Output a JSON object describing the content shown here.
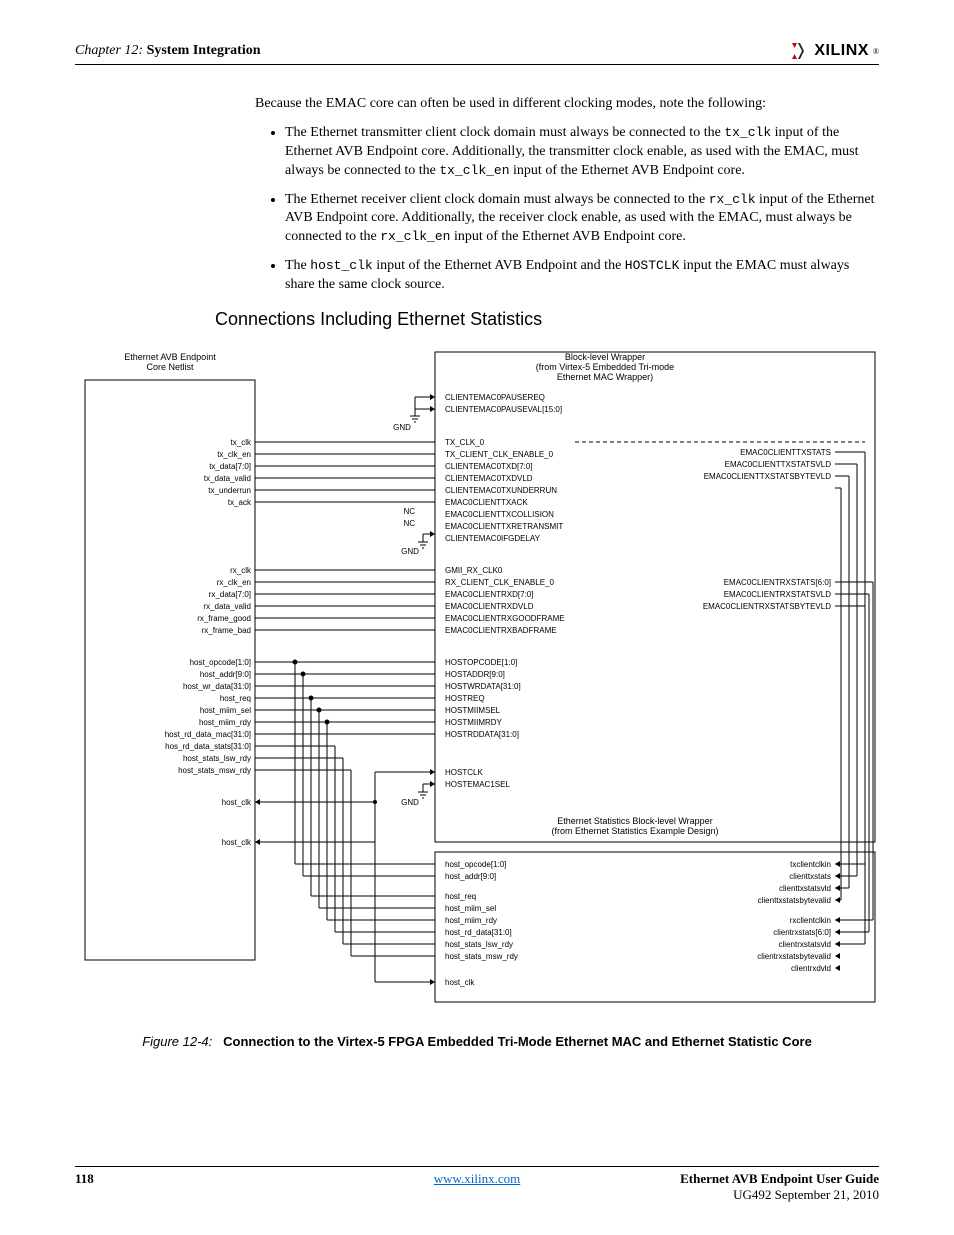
{
  "header": {
    "chapter": "Chapter 12:",
    "title": "System Integration",
    "logo": "XILINX"
  },
  "intro": "Because the EMAC core can often be used in different clocking modes, note the following:",
  "bullets": [
    {
      "pre": "The Ethernet transmitter client clock domain must always be connected to the ",
      "m1": "tx_clk",
      "mid1": " input of the Ethernet AVB Endpoint core. Additionally, the transmitter clock enable, as used with the EMAC, must always be connected to the ",
      "m2": "tx_clk_en",
      "post": " input of the Ethernet AVB Endpoint core."
    },
    {
      "pre": "The Ethernet receiver client clock domain must always be connected to the ",
      "m1": "rx_clk",
      "mid1": " input of the Ethernet AVB Endpoint core. Additionally, the receiver clock enable, as used with the EMAC, must always be connected to the ",
      "m2": "rx_clk_en",
      "post": " input of the Ethernet AVB Endpoint core."
    },
    {
      "pre": "The ",
      "m1": "host_clk",
      "mid1": " input of the Ethernet AVB Endpoint and the ",
      "m2": "HOSTCLK",
      "post": " input the EMAC must always share the same clock source."
    }
  ],
  "section_heading": "Connections Including Ethernet Statistics",
  "diagram": {
    "avb_title1": "Ethernet AVB Endpoint",
    "avb_title2": "Core Netlist",
    "wrap_title1": "Block-level Wrapper",
    "wrap_title2": "(from Virtex-5 Embedded Tri-mode",
    "wrap_title3": "Ethernet MAC Wrapper)",
    "stats_title1": "Ethernet Statistics Block-level Wrapper",
    "stats_title2": "(from Ethernet Statistics Example Design)",
    "gnd": "GND",
    "nc": "NC",
    "pause1": "CLIENTEMAC0PAUSEREQ",
    "pause2": "CLIENTEMAC0PAUSEVAL[15:0]",
    "avb_tx": [
      "tx_clk",
      "tx_clk_en",
      "tx_data[7:0]",
      "tx_data_valid",
      "tx_underrun",
      "tx_ack"
    ],
    "wrap_tx": [
      "TX_CLK_0",
      "TX_CLIENT_CLK_ENABLE_0",
      "CLIENTEMAC0TXD[7:0]",
      "CLIENTEMAC0TXDVLD",
      "CLIENTEMAC0TXUNDERRUN",
      "EMAC0CLIENTTXACK",
      "EMAC0CLIENTTXCOLLISION",
      "EMAC0CLIENTTXRETRANSMIT",
      "CLIENTEMAC0IFGDELAY"
    ],
    "wrap_tx_r": [
      "EMAC0CLIENTTXSTATS",
      "EMAC0CLIENTTXSTATSVLD",
      "EMAC0CLIENTTXSTATSBYTEVLD"
    ],
    "avb_rx": [
      "rx_clk",
      "rx_clk_en",
      "rx_data[7:0]",
      "rx_data_valid",
      "rx_frame_good",
      "rx_frame_bad"
    ],
    "wrap_rx": [
      "GMII_RX_CLK0",
      "RX_CLIENT_CLK_ENABLE_0",
      "EMAC0CLIENTRXD[7:0]",
      "EMAC0CLIENTRXDVLD",
      "EMAC0CLIENTRXGOODFRAME",
      "EMAC0CLIENTRXBADFRAME"
    ],
    "wrap_rx_r": [
      "EMAC0CLIENTRXSTATS[6:0]",
      "EMAC0CLIENTRXSTATSVLD",
      "EMAC0CLIENTRXSTATSBYTEVLD"
    ],
    "avb_host": [
      "host_opcode[1:0]",
      "host_addr[9:0]",
      "host_wr_data[31:0]",
      "host_req",
      "host_miim_sel",
      "host_miim_rdy",
      "host_rd_data_mac[31:0]",
      "hos_rd_data_stats[31:0]",
      "host_stats_lsw_rdy",
      "host_stats_msw_rdy"
    ],
    "wrap_host": [
      "HOSTOPCODE[1:0]",
      "HOSTADDR[9:0]",
      "HOSTWRDATA[31:0]",
      "HOSTREQ",
      "HOSTMIIMSEL",
      "HOSTMIIMRDY",
      "HOSTRDDATA[31:0]"
    ],
    "wrap_host2": [
      "HOSTCLK",
      "HOSTEMAC1SEL"
    ],
    "avb_hostclk": "host_clk",
    "avb_hostclk2": "host_clk",
    "stats_l": [
      "host_opcode[1:0]",
      "host_addr[9:0]"
    ],
    "stats_l2": [
      "host_req",
      "host_miim_sel",
      "host_miim_rdy",
      "host_rd_data[31:0]",
      "host_stats_lsw_rdy",
      "host_stats_msw_rdy"
    ],
    "stats_l3": "host_clk",
    "stats_r": [
      "txclientclkin",
      "clienttxstats",
      "clienttxstatsvld",
      "clienttxstatsbytevalid"
    ],
    "stats_r2": [
      "rxclientclkin",
      "clientrxstats[6:0]",
      "clientrxstatsvld",
      "clientrxstatsbytevalid",
      "clientrxdvld"
    ]
  },
  "figure": {
    "num": "Figure 12-4:",
    "title": "Connection to the Virtex-5 FPGA Embedded Tri-Mode Ethernet MAC and Ethernet Statistic Core"
  },
  "footer": {
    "page": "118",
    "link": "www.xilinx.com",
    "doc": "Ethernet AVB Endpoint User Guide",
    "rev": "UG492 September 21, 2010"
  }
}
